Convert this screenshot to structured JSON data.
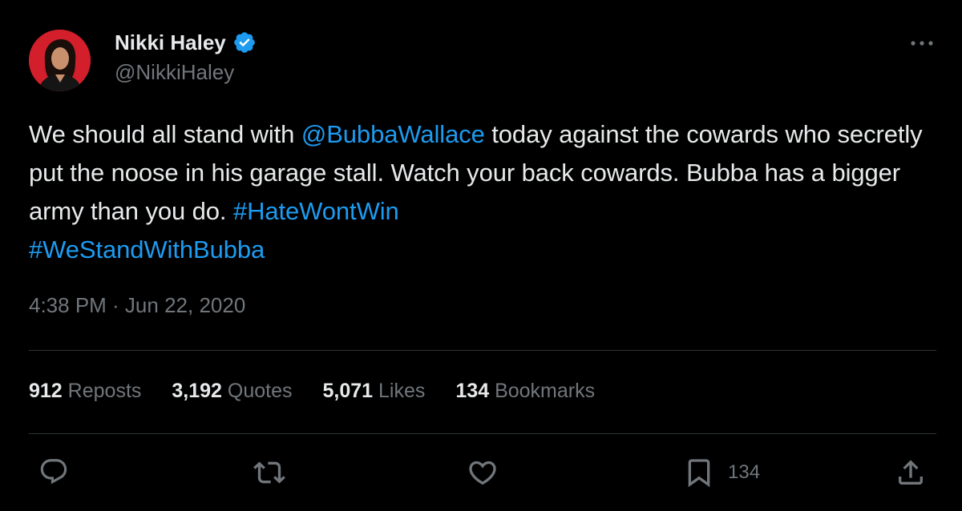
{
  "author": {
    "display_name": "Nikki Haley",
    "handle": "@NikkiHaley",
    "verified": true
  },
  "tweet": {
    "segments": [
      {
        "text": "We should all stand with ",
        "type": "text"
      },
      {
        "text": "@BubbaWallace",
        "type": "mention"
      },
      {
        "text": " today against the cowards who secretly put the noose in his garage stall. Watch your back cowards. Bubba has a bigger army than you do. ",
        "type": "text"
      },
      {
        "text": "#HateWontWin",
        "type": "hashtag"
      },
      {
        "text": " ",
        "type": "text"
      },
      {
        "text": "#WeStandWithBubba",
        "type": "hashtag"
      }
    ],
    "timestamp": "4:38 PM · Jun 22, 2020"
  },
  "stats": {
    "reposts": {
      "count": "912",
      "label": "Reposts"
    },
    "quotes": {
      "count": "3,192",
      "label": "Quotes"
    },
    "likes": {
      "count": "5,071",
      "label": "Likes"
    },
    "bookmarks": {
      "count": "134",
      "label": "Bookmarks"
    }
  },
  "actions": {
    "reply": {
      "icon": "reply-icon"
    },
    "repost": {
      "icon": "repost-icon"
    },
    "like": {
      "icon": "heart-icon"
    },
    "bookmark": {
      "icon": "bookmark-icon",
      "count": "134"
    },
    "share": {
      "icon": "share-icon"
    }
  },
  "colors": {
    "background": "#000000",
    "text": "#e7e9ea",
    "secondary": "#71767b",
    "accent": "#1d9bf0",
    "divider": "#2f3336",
    "avatar_bg": "#d21f2b"
  }
}
